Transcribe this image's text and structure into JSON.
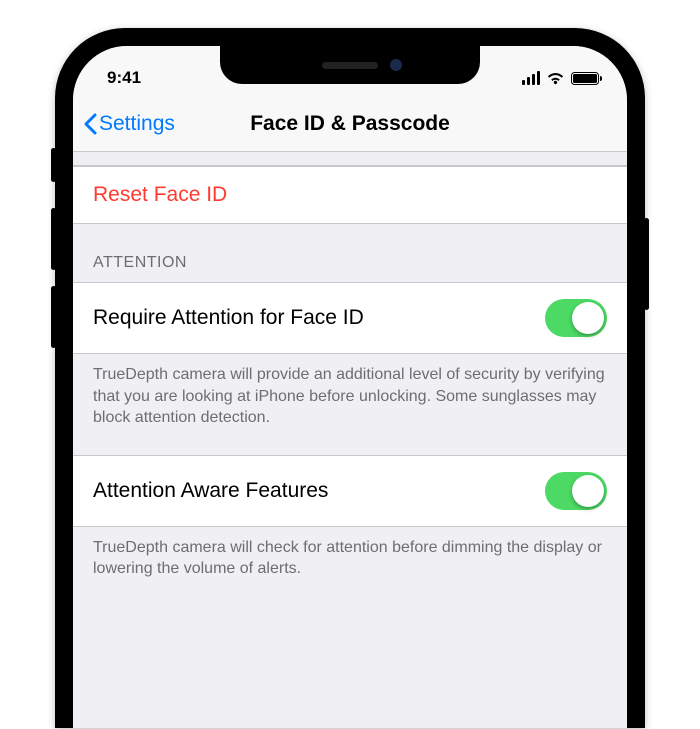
{
  "status": {
    "time": "9:41"
  },
  "nav": {
    "back": "Settings",
    "title": "Face ID & Passcode"
  },
  "reset": {
    "label": "Reset Face ID"
  },
  "attention": {
    "header": "ATTENTION",
    "requireLabel": "Require Attention for Face ID",
    "requireOn": true,
    "requireFooter": "TrueDepth camera will provide an additional level of security by verifying that you are looking at iPhone before unlocking. Some sunglasses may block attention detection.",
    "awareLabel": "Attention Aware Features",
    "awareOn": true,
    "awareFooter": "TrueDepth camera will check for attention before dimming the display or lowering the volume of alerts."
  }
}
